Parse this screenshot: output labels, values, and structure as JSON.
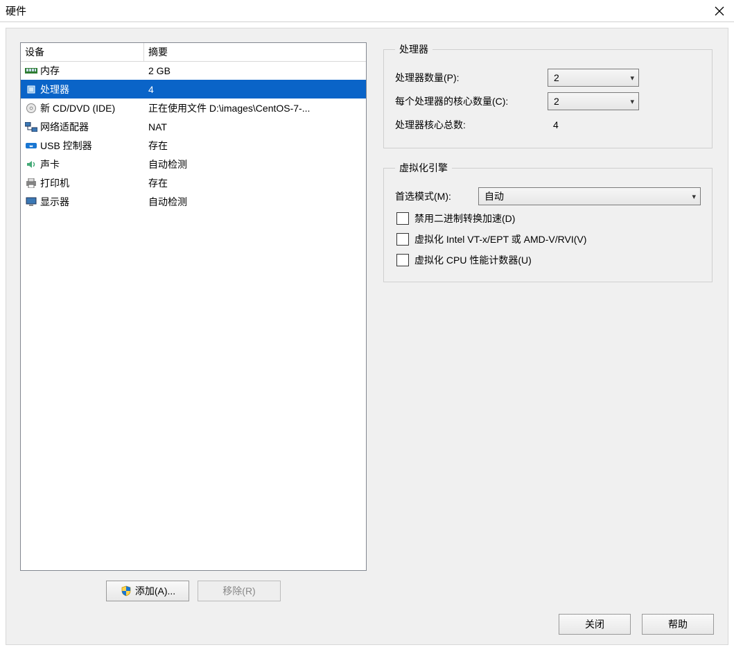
{
  "window": {
    "title": "硬件"
  },
  "device_list": {
    "col_device": "设备",
    "col_summary": "摘要",
    "rows": [
      {
        "icon": "memory-icon",
        "name": "内存",
        "summary": "2 GB",
        "selected": false
      },
      {
        "icon": "cpu-icon",
        "name": "处理器",
        "summary": "4",
        "selected": true
      },
      {
        "icon": "disc-icon",
        "name": "新 CD/DVD (IDE)",
        "summary": "正在使用文件 D:\\images\\CentOS-7-...",
        "selected": false
      },
      {
        "icon": "network-icon",
        "name": "网络适配器",
        "summary": "NAT",
        "selected": false
      },
      {
        "icon": "usb-icon",
        "name": "USB 控制器",
        "summary": "存在",
        "selected": false
      },
      {
        "icon": "sound-icon",
        "name": "声卡",
        "summary": "自动检测",
        "selected": false
      },
      {
        "icon": "printer-icon",
        "name": "打印机",
        "summary": "存在",
        "selected": false
      },
      {
        "icon": "display-icon",
        "name": "显示器",
        "summary": "自动检测",
        "selected": false
      }
    ]
  },
  "left_buttons": {
    "add": "添加(A)...",
    "remove": "移除(R)"
  },
  "processors_group": {
    "legend": "处理器",
    "count_label": "处理器数量(P):",
    "count_value": "2",
    "cores_label": "每个处理器的核心数量(C):",
    "cores_value": "2",
    "total_label": "处理器核心总数:",
    "total_value": "4"
  },
  "virt_group": {
    "legend": "虚拟化引擎",
    "mode_label": "首选模式(M):",
    "mode_value": "自动",
    "chk1": "禁用二进制转换加速(D)",
    "chk2": "虚拟化 Intel VT-x/EPT 或 AMD-V/RVI(V)",
    "chk3": "虚拟化 CPU 性能计数器(U)"
  },
  "bottom": {
    "close": "关闭",
    "help": "帮助"
  }
}
